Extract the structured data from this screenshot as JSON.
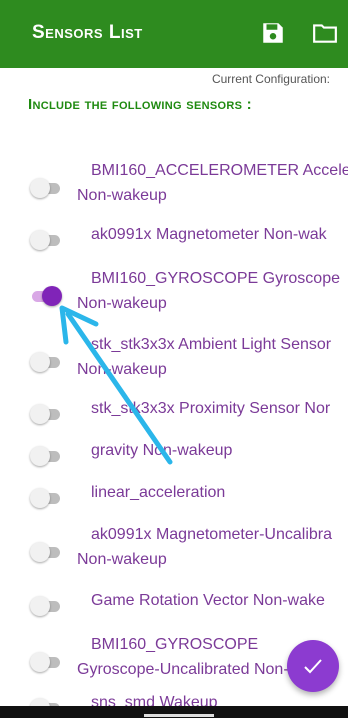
{
  "appbar": {
    "title": "Sensors List"
  },
  "config_label": "Current Configuration:",
  "heading": "Include the following sensors :",
  "sensors": [
    {
      "line1": "BMI160_ACCELEROMETER Accele",
      "line2": "Non-wakeup",
      "enabled": false
    },
    {
      "line1": "ak0991x Magnetometer Non-wak",
      "line2": "",
      "enabled": false
    },
    {
      "line1": "BMI160_GYROSCOPE Gyroscope",
      "line2": "Non-wakeup",
      "enabled": true
    },
    {
      "line1": "stk_stk3x3x Ambient Light Sensor",
      "line2": "Non-wakeup",
      "enabled": false
    },
    {
      "line1": "stk_stk3x3x Proximity Sensor Nor",
      "line2": "",
      "enabled": false
    },
    {
      "line1": "gravity  Non-wakeup",
      "line2": "",
      "enabled": false
    },
    {
      "line1": "linear_acceleration",
      "line2": "",
      "enabled": false
    },
    {
      "line1": "ak0991x Magnetometer-Uncalibra",
      "line2": "Non-wakeup",
      "enabled": false
    },
    {
      "line1": "Game Rotation Vector  Non-wake",
      "line2": "",
      "enabled": false
    },
    {
      "line1": "BMI160_GYROSCOPE",
      "line2": "Gyroscope-Uncalibrated Non-wake",
      "enabled": false
    },
    {
      "line1": "sns_smd  Wakeup",
      "line2": "",
      "enabled": false
    }
  ],
  "colors": {
    "appbar": "#2e8b1f",
    "accent": "#8c3bd0",
    "heading": "#1f8a10",
    "label": "#7b3a98",
    "annotation_arrow": "#2bb6ea"
  }
}
